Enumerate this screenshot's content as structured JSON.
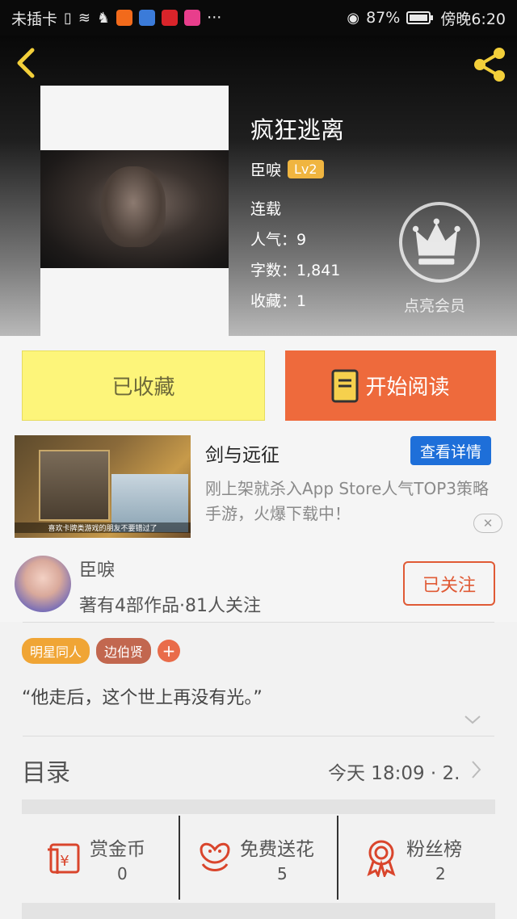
{
  "status_bar": {
    "carrier": "未插卡",
    "battery": "87%",
    "time": "傍晚6:20",
    "more": "···",
    "app_icon_colors": [
      "#f26a1b",
      "#3b7bd9",
      "#d9242a",
      "#e83e8c"
    ]
  },
  "header": {
    "back_icon": "back-chevron-icon",
    "share_icon": "share-icon",
    "title": "疯狂逃离",
    "author": "臣唳",
    "level": "Lv2",
    "status": "连载",
    "popularity": "人气：9",
    "word_count": "字数：1,841",
    "favorites": "收藏：1",
    "vip_label": "点亮会员"
  },
  "actions": {
    "favorited_label": "已收藏",
    "start_reading_label": "开始阅读"
  },
  "ad": {
    "title": "剑与远征",
    "detail_button": "查看详情",
    "description": "刚上架就杀入App Store人气TOP3策略手游，火爆下载中！",
    "image_caption": "喜欢卡牌类游戏的朋友不要错过了",
    "close_symbol": "✕"
  },
  "author_block": {
    "name": "臣唳",
    "stats": "著有4部作品·81人关注",
    "follow_label": "已关注"
  },
  "tags": [
    {
      "label": "明星同人",
      "color": "#f0a535"
    },
    {
      "label": "边伯贤",
      "color": "#c2674f"
    }
  ],
  "tag_add_symbol": "+",
  "description": "“他走后，这个世上再没有光。”",
  "toc": {
    "label": "目录",
    "info": "今天 18:09 · 2."
  },
  "stats": [
    {
      "label": "赏金币",
      "value": "0",
      "icon": "reward-coin-icon"
    },
    {
      "label": "免费送花",
      "value": "5",
      "icon": "flower-icon"
    },
    {
      "label": "粉丝榜",
      "value": "2",
      "icon": "medal-icon"
    }
  ],
  "colors": {
    "accent_orange": "#ee6a3c",
    "favorite_yellow": "#fdf57a",
    "ad_blue": "#1e6fd9",
    "icon_red": "#d9452c"
  }
}
